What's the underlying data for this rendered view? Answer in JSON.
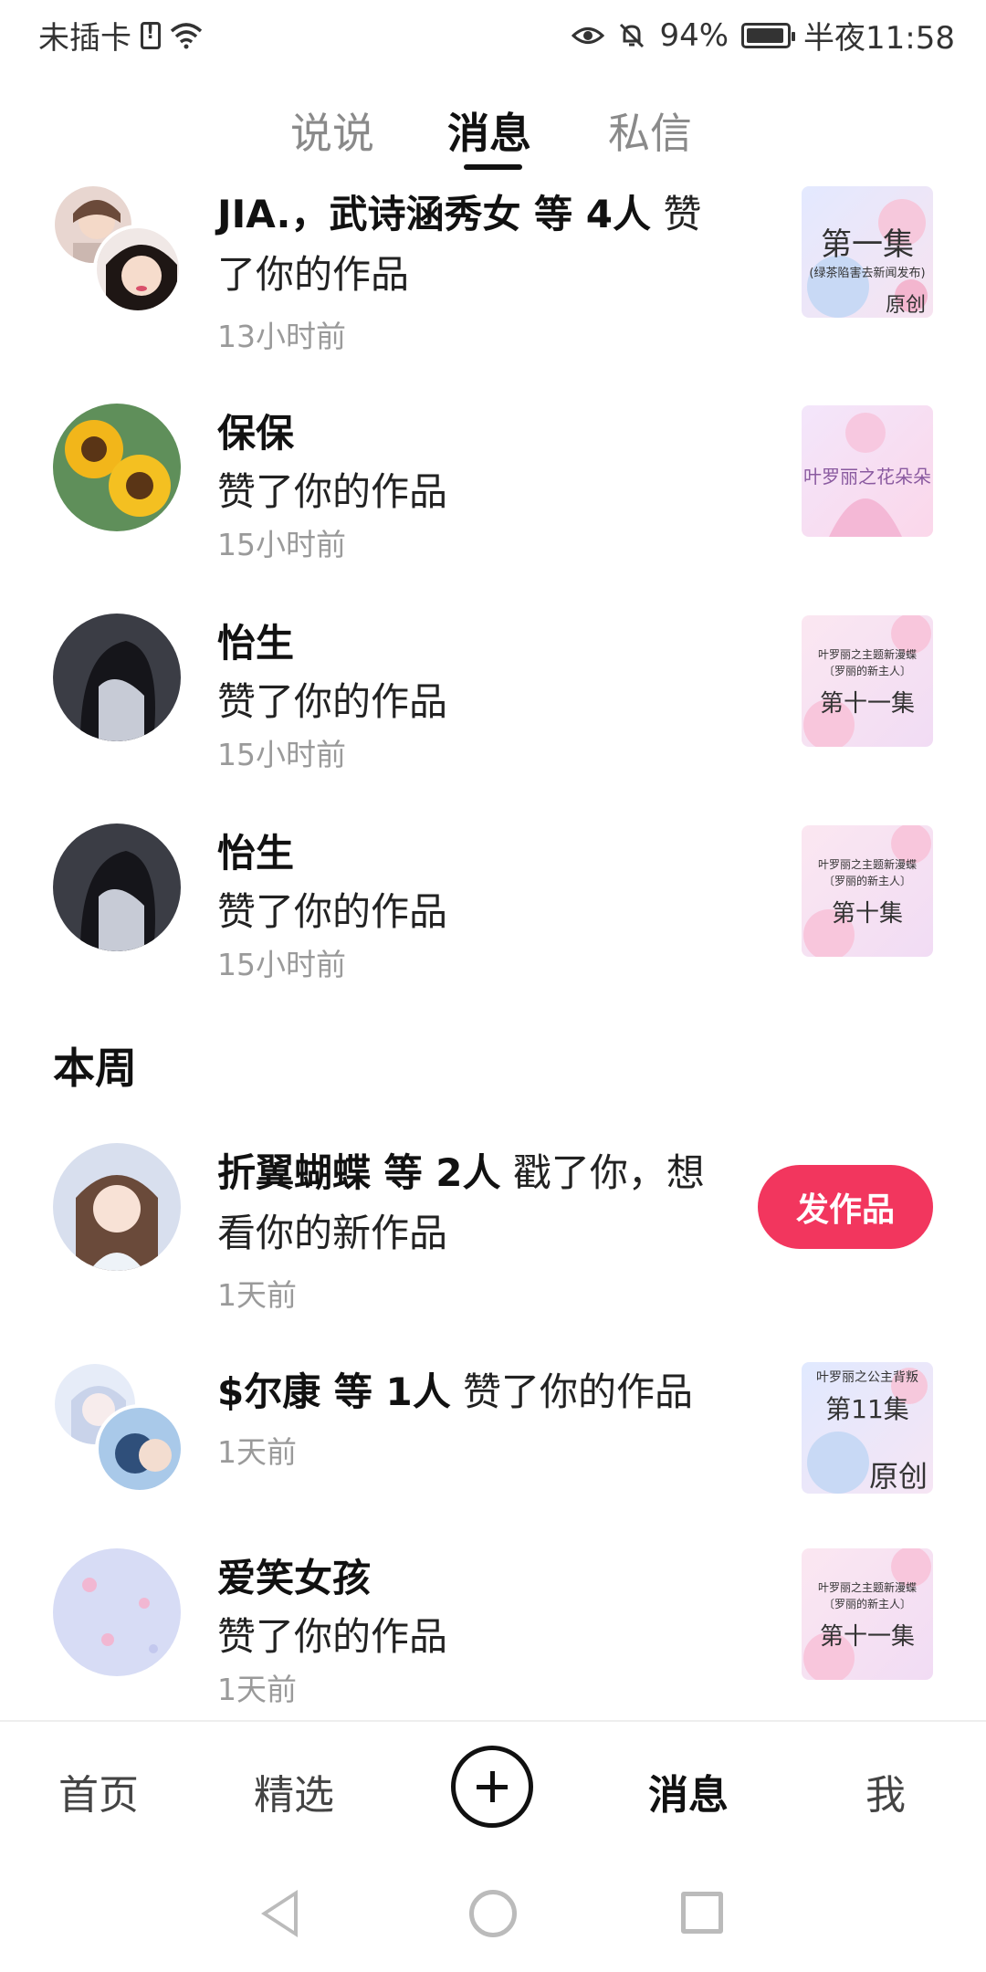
{
  "status_bar": {
    "carrier": "未插卡",
    "battery": "94%",
    "time": "半夜11:58"
  },
  "tabs": [
    {
      "label": "说说"
    },
    {
      "label": "消息"
    },
    {
      "label": "私信"
    }
  ],
  "notifications": [
    {
      "names": "JIA.，武诗涵秀女 等 4人",
      "action": " 赞了你的作品",
      "time": "13小时前",
      "thumb_title": "第一集",
      "thumb_sub": "(绿茶陷害去新闻发布)",
      "thumb_tag": "原创"
    },
    {
      "names": "保保",
      "action": "赞了你的作品",
      "time": "15小时前",
      "thumb_title": "叶罗丽之花朵朵"
    },
    {
      "names": "怡生",
      "action": "赞了你的作品",
      "time": "15小时前",
      "thumb_top": "叶罗丽之主题新漫蝶",
      "thumb_mid": "〔罗丽的新主人〕",
      "thumb_title": "第十一集"
    },
    {
      "names": "怡生",
      "action": "赞了你的作品",
      "time": "15小时前",
      "thumb_top": "叶罗丽之主题新漫蝶",
      "thumb_mid": "〔罗丽的新主人〕",
      "thumb_title": "第十集"
    }
  ],
  "section_week": "本周",
  "week_items": [
    {
      "names": "折翼蝴蝶 等 2人",
      "action": " 戳了你，想看你的新作品",
      "time": "1天前",
      "button": "发作品"
    },
    {
      "names": "$尔康 等 1人",
      "action": " 赞了你的作品",
      "time": "1天前",
      "thumb_title": "第11集",
      "thumb_top": "叶罗丽之公主背叛",
      "thumb_tag": "原创"
    },
    {
      "names": "爱笑女孩",
      "action": "赞了你的作品",
      "time": "1天前",
      "thumb_top": "叶罗丽之主题新漫蝶",
      "thumb_mid": "〔罗丽的新主人〕",
      "thumb_title": "第十一集"
    }
  ],
  "bottom_nav": [
    {
      "label": "首页"
    },
    {
      "label": "精选"
    },
    {
      "label": "消息"
    },
    {
      "label": "我"
    }
  ],
  "colors": {
    "accent": "#f2365e",
    "muted": "#9a9a9a"
  }
}
